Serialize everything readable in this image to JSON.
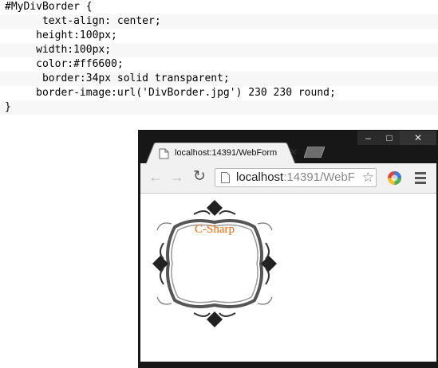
{
  "code": {
    "lines": [
      "#MyDivBorder {",
      "      text-align: center;",
      "     height:100px;",
      "     width:100px;",
      "     color:#ff6600;",
      "      border:34px solid transparent;",
      "     border-image:url('DivBorder.jpg') 230 230 round;",
      "}"
    ]
  },
  "browser": {
    "tab_title": "localhost:14391/WebForm",
    "tab_close": "✕",
    "controls": {
      "minimize": "‒",
      "maximize": "□",
      "close": "✕"
    },
    "nav": {
      "back": "←",
      "forward": "→",
      "reload": "↻"
    },
    "address": {
      "host": "localhost",
      "path": ":14391/WebF"
    },
    "star": "☆"
  },
  "page": {
    "div_text": "C-Sharp",
    "text_color": "#ff6600"
  }
}
